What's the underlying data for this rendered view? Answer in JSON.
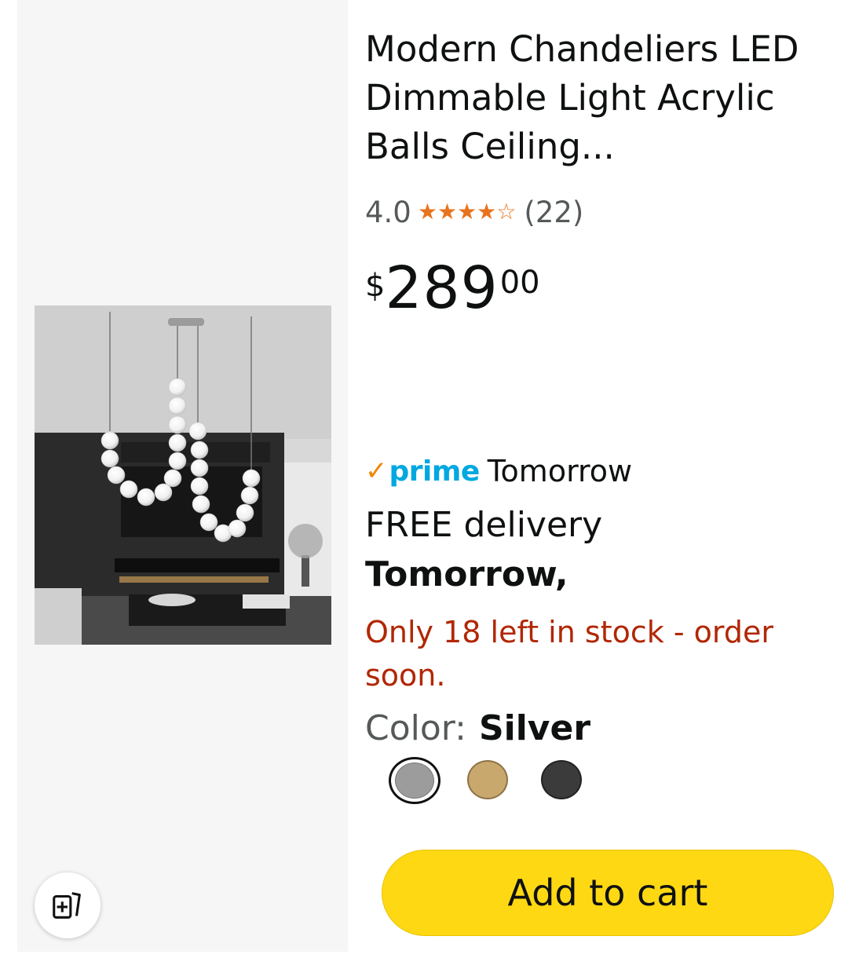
{
  "product": {
    "title": "Modern Chandeliers LED Dimmable Light Acrylic Balls Ceiling...",
    "rating_value": "4.0",
    "rating_stars": 4.0,
    "review_count": "(22)",
    "price": {
      "symbol": "$",
      "whole": "289",
      "fraction": "00"
    },
    "delivery": {
      "prime_check": "✓",
      "prime_label": "prime",
      "prime_when": "Tomorrow",
      "free_delivery": "FREE delivery",
      "date": "Tomorrow,"
    },
    "stock_message": "Only 18 left in stock - order soon.",
    "color": {
      "label": "Color:",
      "selected": "Silver",
      "swatch_colors": [
        "#9c9c9c",
        "#c9a86e",
        "#3b3b3b"
      ]
    },
    "add_to_cart": "Add to cart"
  },
  "icons": {
    "rating": "star-icon",
    "compare": "compare-add-icon"
  },
  "colors": {
    "price_text": "#0f1111",
    "stock_red": "#b12704",
    "prime_blue": "#00a8e1",
    "prime_check": "#f08804",
    "star_orange": "#e8731d",
    "cart_yellow": "#ffd814"
  }
}
